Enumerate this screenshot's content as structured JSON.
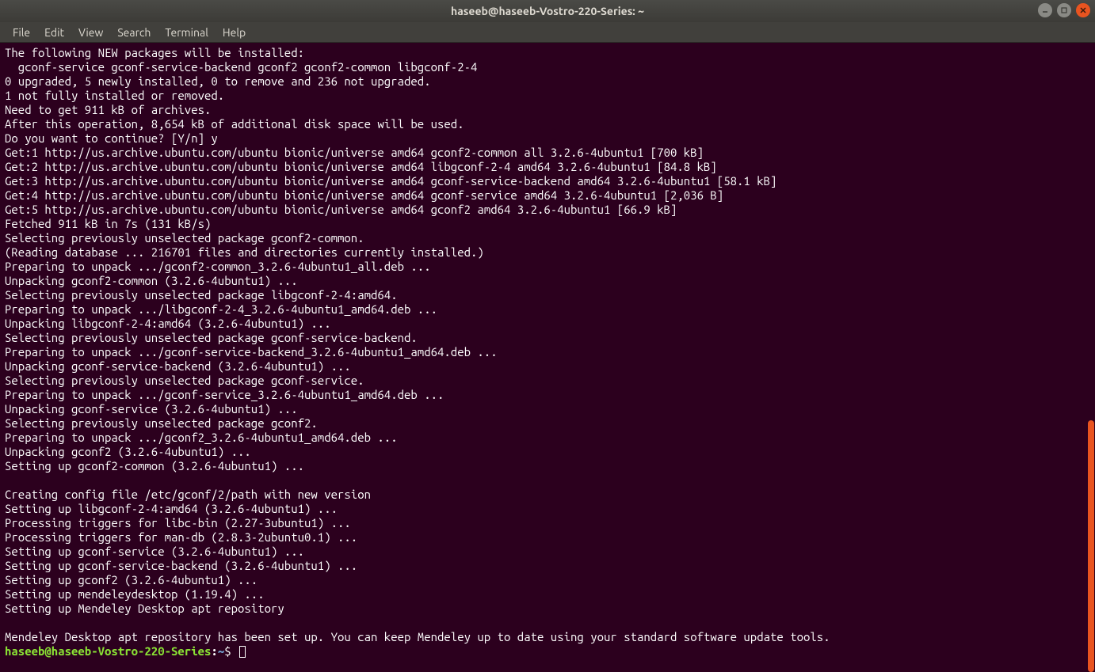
{
  "window": {
    "title": "haseeb@haseeb-Vostro-220-Series: ~"
  },
  "menu": {
    "items": [
      "File",
      "Edit",
      "View",
      "Search",
      "Terminal",
      "Help"
    ]
  },
  "terminal": {
    "lines": [
      "The following NEW packages will be installed:",
      "  gconf-service gconf-service-backend gconf2 gconf2-common libgconf-2-4",
      "0 upgraded, 5 newly installed, 0 to remove and 236 not upgraded.",
      "1 not fully installed or removed.",
      "Need to get 911 kB of archives.",
      "After this operation, 8,654 kB of additional disk space will be used.",
      "Do you want to continue? [Y/n] y",
      "Get:1 http://us.archive.ubuntu.com/ubuntu bionic/universe amd64 gconf2-common all 3.2.6-4ubuntu1 [700 kB]",
      "Get:2 http://us.archive.ubuntu.com/ubuntu bionic/universe amd64 libgconf-2-4 amd64 3.2.6-4ubuntu1 [84.8 kB]",
      "Get:3 http://us.archive.ubuntu.com/ubuntu bionic/universe amd64 gconf-service-backend amd64 3.2.6-4ubuntu1 [58.1 kB]",
      "Get:4 http://us.archive.ubuntu.com/ubuntu bionic/universe amd64 gconf-service amd64 3.2.6-4ubuntu1 [2,036 B]",
      "Get:5 http://us.archive.ubuntu.com/ubuntu bionic/universe amd64 gconf2 amd64 3.2.6-4ubuntu1 [66.9 kB]",
      "Fetched 911 kB in 7s (131 kB/s)",
      "Selecting previously unselected package gconf2-common.",
      "(Reading database ... 216701 files and directories currently installed.)",
      "Preparing to unpack .../gconf2-common_3.2.6-4ubuntu1_all.deb ...",
      "Unpacking gconf2-common (3.2.6-4ubuntu1) ...",
      "Selecting previously unselected package libgconf-2-4:amd64.",
      "Preparing to unpack .../libgconf-2-4_3.2.6-4ubuntu1_amd64.deb ...",
      "Unpacking libgconf-2-4:amd64 (3.2.6-4ubuntu1) ...",
      "Selecting previously unselected package gconf-service-backend.",
      "Preparing to unpack .../gconf-service-backend_3.2.6-4ubuntu1_amd64.deb ...",
      "Unpacking gconf-service-backend (3.2.6-4ubuntu1) ...",
      "Selecting previously unselected package gconf-service.",
      "Preparing to unpack .../gconf-service_3.2.6-4ubuntu1_amd64.deb ...",
      "Unpacking gconf-service (3.2.6-4ubuntu1) ...",
      "Selecting previously unselected package gconf2.",
      "Preparing to unpack .../gconf2_3.2.6-4ubuntu1_amd64.deb ...",
      "Unpacking gconf2 (3.2.6-4ubuntu1) ...",
      "Setting up gconf2-common (3.2.6-4ubuntu1) ...",
      "",
      "Creating config file /etc/gconf/2/path with new version",
      "Setting up libgconf-2-4:amd64 (3.2.6-4ubuntu1) ...",
      "Processing triggers for libc-bin (2.27-3ubuntu1) ...",
      "Processing triggers for man-db (2.8.3-2ubuntu0.1) ...",
      "Setting up gconf-service (3.2.6-4ubuntu1) ...",
      "Setting up gconf-service-backend (3.2.6-4ubuntu1) ...",
      "Setting up gconf2 (3.2.6-4ubuntu1) ...",
      "Setting up mendeleydesktop (1.19.4) ...",
      "Setting up Mendeley Desktop apt repository",
      "",
      "Mendeley Desktop apt repository has been set up. You can keep Mendeley up to date using your standard software update tools."
    ],
    "prompt": {
      "user_host": "haseeb@haseeb-Vostro-220-Series",
      "colon": ":",
      "path": "~",
      "dollar": "$"
    }
  },
  "scrollbar": {
    "thumb_top_pct": 60,
    "thumb_height_pct": 40
  },
  "colors": {
    "bg": "#2c001e",
    "text": "#ffffff",
    "accent": "#e95420",
    "prompt_user": "#8ae234",
    "prompt_path": "#729fcf",
    "titlebar": "#3c3b37"
  }
}
